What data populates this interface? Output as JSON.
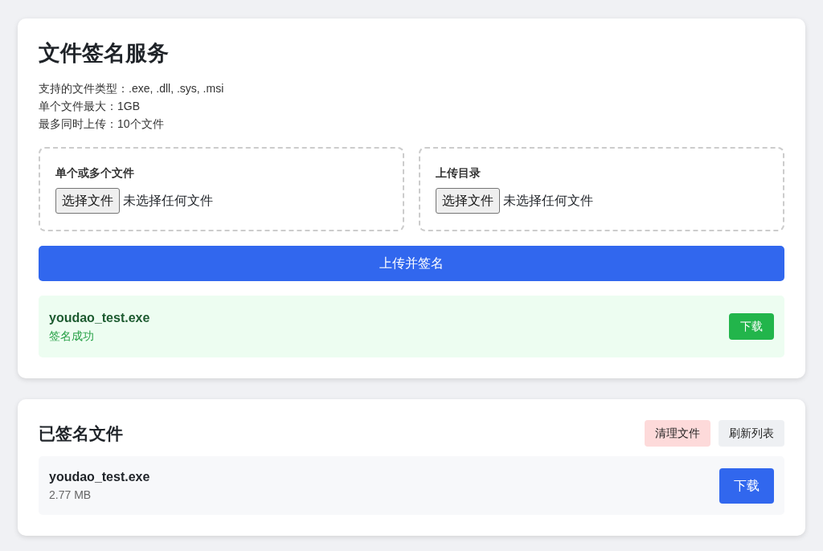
{
  "upload_card": {
    "title": "文件签名服务",
    "info_lines": [
      "支持的文件类型：.exe, .dll, .sys, .msi",
      "单个文件最大：1GB",
      "最多同时上传：10个文件"
    ],
    "upload_areas": [
      {
        "label": "单个或多个文件",
        "button": "选择文件",
        "status": "未选择任何文件"
      },
      {
        "label": "上传目录",
        "button": "选择文件",
        "status": "未选择任何文件"
      }
    ],
    "submit_button": "上传并签名",
    "results": [
      {
        "kind": "success",
        "filename": "youdao_test.exe",
        "message": "签名成功",
        "button": "下载"
      }
    ]
  },
  "signed_card": {
    "title": "已签名文件",
    "actions": [
      {
        "kind": "danger",
        "label": "清理文件"
      },
      {
        "kind": "neutral",
        "label": "刷新列表"
      }
    ],
    "files": [
      {
        "name": "youdao_test.exe",
        "size": "2.77 MB",
        "button": "下载"
      }
    ]
  }
}
